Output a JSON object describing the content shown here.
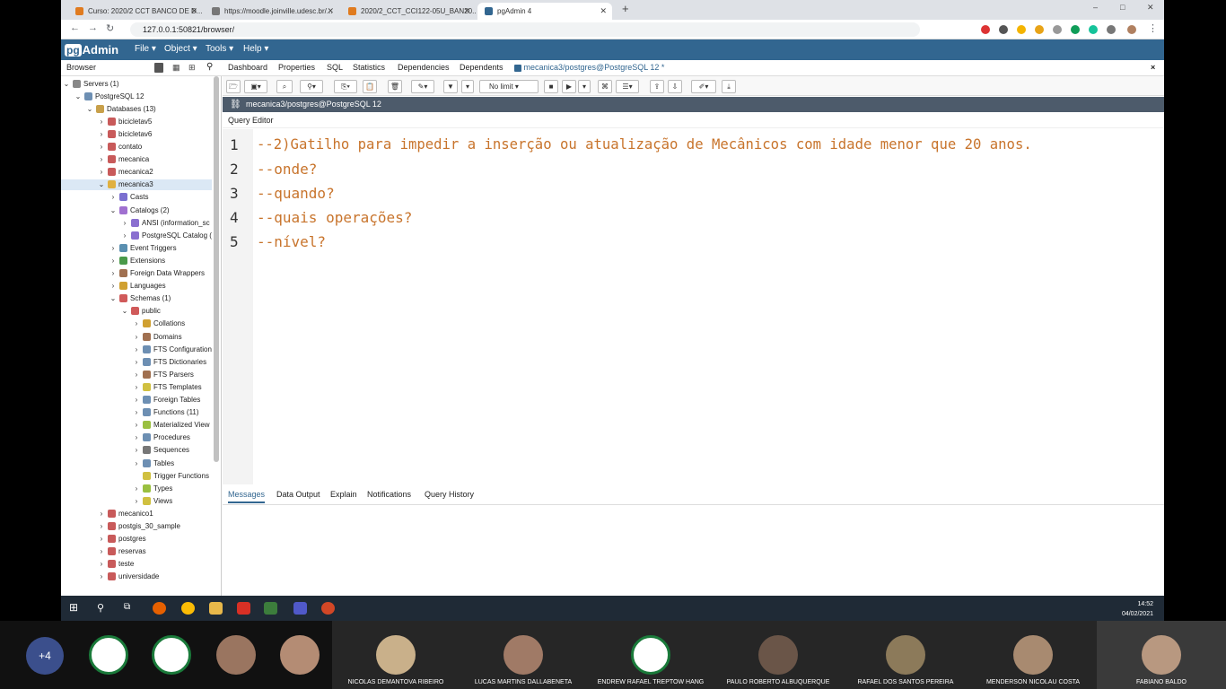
{
  "browser": {
    "tabs": [
      {
        "title": "Curso: 2020/2 CCT BANCO DE D...",
        "color": "#e07b1f"
      },
      {
        "title": "https://moodle.joinville.udesc.br/...",
        "color": "#777777"
      },
      {
        "title": "2020/2_CCT_CCI122-05U_BAN20...",
        "color": "#e07b1f"
      },
      {
        "title": "pgAdmin 4",
        "color": "#326690"
      }
    ],
    "url": "127.0.0.1:50821/browser/"
  },
  "app": {
    "logo_pg": "pg",
    "logo_text": "Admin",
    "menus": [
      "File ▾",
      "Object ▾",
      "Tools ▾",
      "Help ▾"
    ],
    "brand_color": "#326690"
  },
  "panel": {
    "browser_label": "Browser",
    "tabs": [
      "Dashboard",
      "Properties",
      "SQL",
      "Statistics",
      "Dependencies",
      "Dependents"
    ],
    "active_tab": "mecanica3/postgres@PostgreSQL 12 *",
    "close": "×"
  },
  "tree": [
    {
      "label": "Servers (1)",
      "arrow": "⌄",
      "indent": 0
    },
    {
      "label": "PostgreSQL 12",
      "arrow": "⌄",
      "indent": 1
    },
    {
      "label": "Databases (13)",
      "arrow": "⌄",
      "indent": 2
    },
    {
      "label": "bicicletav5",
      "arrow": "›",
      "indent": 3
    },
    {
      "label": "bicicletav6",
      "arrow": "›",
      "indent": 3
    },
    {
      "label": "contato",
      "arrow": "›",
      "indent": 3
    },
    {
      "label": "mecanica",
      "arrow": "›",
      "indent": 3
    },
    {
      "label": "mecanica2",
      "arrow": "›",
      "indent": 3
    },
    {
      "label": "mecanica3",
      "arrow": "⌄",
      "indent": 3,
      "selected": true
    },
    {
      "label": "Casts",
      "arrow": "›",
      "indent": 4
    },
    {
      "label": "Catalogs (2)",
      "arrow": "⌄",
      "indent": 4
    },
    {
      "label": "ANSI (information_sc",
      "arrow": "›",
      "indent": 5
    },
    {
      "label": "PostgreSQL Catalog (",
      "arrow": "›",
      "indent": 5
    },
    {
      "label": "Event Triggers",
      "arrow": "›",
      "indent": 4
    },
    {
      "label": "Extensions",
      "arrow": "›",
      "indent": 4
    },
    {
      "label": "Foreign Data Wrappers",
      "arrow": "›",
      "indent": 4
    },
    {
      "label": "Languages",
      "arrow": "›",
      "indent": 4
    },
    {
      "label": "Schemas (1)",
      "arrow": "⌄",
      "indent": 4
    },
    {
      "label": "public",
      "arrow": "⌄",
      "indent": 5
    },
    {
      "label": "Collations",
      "arrow": "›",
      "indent": 6
    },
    {
      "label": "Domains",
      "arrow": "›",
      "indent": 6
    },
    {
      "label": "FTS Configuration",
      "arrow": "›",
      "indent": 6
    },
    {
      "label": "FTS Dictionaries",
      "arrow": "›",
      "indent": 6
    },
    {
      "label": "FTS Parsers",
      "arrow": "›",
      "indent": 6
    },
    {
      "label": "FTS Templates",
      "arrow": "›",
      "indent": 6
    },
    {
      "label": "Foreign Tables",
      "arrow": "›",
      "indent": 6
    },
    {
      "label": "Functions (11)",
      "arrow": "›",
      "indent": 6
    },
    {
      "label": "Materialized View",
      "arrow": "›",
      "indent": 6
    },
    {
      "label": "Procedures",
      "arrow": "›",
      "indent": 6
    },
    {
      "label": "Sequences",
      "arrow": "›",
      "indent": 6
    },
    {
      "label": "Tables",
      "arrow": "›",
      "indent": 6
    },
    {
      "label": "Trigger Functions",
      "arrow": "",
      "indent": 6
    },
    {
      "label": "Types",
      "arrow": "›",
      "indent": 6
    },
    {
      "label": "Views",
      "arrow": "›",
      "indent": 6
    },
    {
      "label": "mecanico1",
      "arrow": "›",
      "indent": 3
    },
    {
      "label": "postgis_30_sample",
      "arrow": "›",
      "indent": 3
    },
    {
      "label": "postgres",
      "arrow": "›",
      "indent": 3
    },
    {
      "label": "reservas",
      "arrow": "›",
      "indent": 3
    },
    {
      "label": "teste",
      "arrow": "›",
      "indent": 3
    },
    {
      "label": "universidade",
      "arrow": "›",
      "indent": 3
    }
  ],
  "query": {
    "limit": "No limit",
    "connection": "mecanica3/postgres@PostgreSQL 12",
    "editor_label": "Query Editor",
    "lines": [
      {
        "n": "1",
        "text": "--2)Gatilho para impedir a inserção ou atualização de Mecânicos com idade menor que 20 anos."
      },
      {
        "n": "2",
        "text": "--onde?"
      },
      {
        "n": "3",
        "text": "--quando?"
      },
      {
        "n": "4",
        "text": "--quais operações?"
      },
      {
        "n": "5",
        "text": "--nível?"
      }
    ],
    "comment_color": "#c8742c"
  },
  "results": {
    "tabs": [
      "Messages",
      "Data Output",
      "Explain",
      "Notifications",
      "Query History"
    ]
  },
  "taskbar": {
    "time": "14:52",
    "date": "04/02/2021"
  },
  "participants": {
    "more": "+4",
    "names": [
      "NICOLAS DEMANTOVA RIBEIRO",
      "LUCAS MARTINS DALLABENETA",
      "ENDREW RAFAEL TREPTOW HANG",
      "PAULO ROBERTO ALBUQUERQUE",
      "RAFAEL DOS SANTOS PEREIRA",
      "MENDERSON NICOLAU COSTA",
      "FABIANO BALDO"
    ]
  }
}
